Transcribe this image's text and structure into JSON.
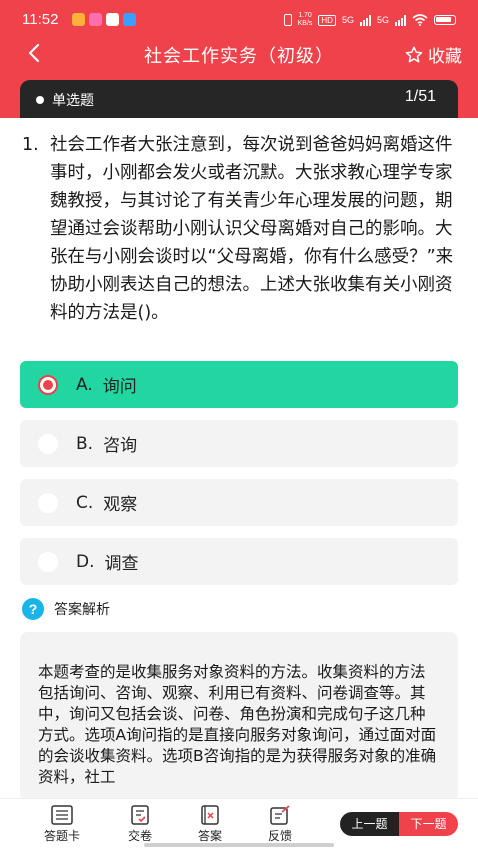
{
  "status_bar": {
    "time": "11:52",
    "speed": "1.70",
    "speed_unit": "KB/s",
    "hd": "HD",
    "net1": "5G",
    "net2": "5G"
  },
  "nav": {
    "title": "社会工作实务（初级）",
    "favorite_label": "收藏"
  },
  "question_bar": {
    "type": "单选题",
    "progress": "1/51"
  },
  "question": {
    "number": "1.",
    "text": "社会工作者大张注意到，每次说到爸爸妈妈离婚这件事时，小刚都会发火或者沉默。大张求教心理学专家魏教授，与其讨论了有关青少年心理发展的问题，期望通过会谈帮助小刚认识父母离婚对自己的影响。大张在与小刚会谈时以“父母离婚，你有什么感受？”来协助小刚表达自己的想法。上述大张收集有关小刚资料的方法是()。"
  },
  "options": [
    {
      "key": "A.",
      "text": "询问",
      "selected": true
    },
    {
      "key": "B.",
      "text": "咨询",
      "selected": false
    },
    {
      "key": "C.",
      "text": "观察",
      "selected": false
    },
    {
      "key": "D.",
      "text": "调查",
      "selected": false
    }
  ],
  "analysis": {
    "title": "答案解析",
    "text": "本题考查的是收集服务对象资料的方法。收集资料的方法包括询问、咨询、观察、利用已有资料、问卷调查等。其中，询问又包括会谈、问卷、角色扮演和完成句子这几种方式。选项A询问指的是直接向服务对象询问，通过面对面的会谈收集资料。选项B咨询指的是为获得服务对象的准确资料，社工"
  },
  "tabbar": {
    "answer_card": "答题卡",
    "submit": "交卷",
    "answer": "答案",
    "feedback": "反馈",
    "prev": "上一题",
    "next": "下一题"
  },
  "colors": {
    "brand_red": "#f0424a",
    "selected_green": "#22d6a2",
    "question_bar": "#262626",
    "help_blue": "#19b5e8"
  }
}
